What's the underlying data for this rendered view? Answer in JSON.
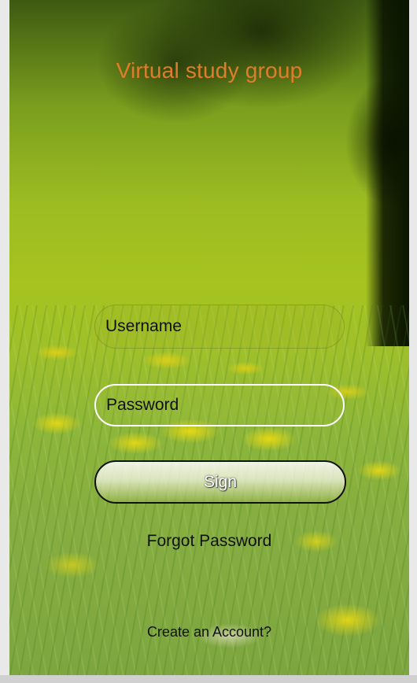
{
  "app": {
    "title": "Virtual study group"
  },
  "login_form": {
    "username_placeholder": "Username",
    "password_placeholder": "Password",
    "sign_label": "Sign",
    "forgot_password_label": "Forgot Password",
    "create_account_label": "Create an Account?"
  },
  "colors": {
    "title": "#e07d2c",
    "password_border": "#ffffff",
    "button_border": "#111111"
  }
}
